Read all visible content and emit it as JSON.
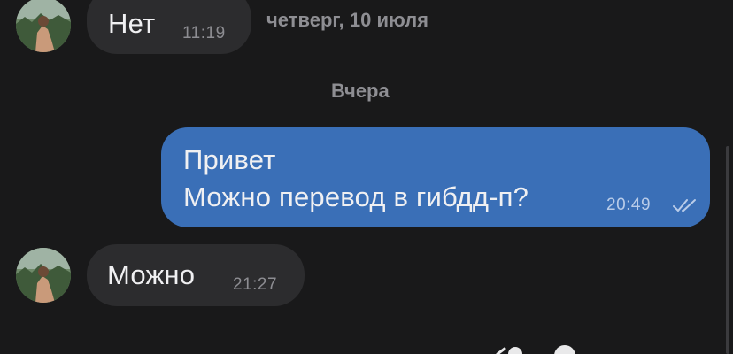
{
  "messages": [
    {
      "direction": "incoming",
      "text": "Нет",
      "time": "11:19"
    },
    {
      "direction": "outgoing",
      "lines": [
        "Привет",
        "Можно перевод в гибдд-п?"
      ],
      "time": "20:49",
      "status_icon": "double-check-icon"
    },
    {
      "direction": "incoming",
      "text": "Можно",
      "time": "21:27"
    }
  ],
  "date_separators": {
    "sticky": "четверг, 10 июля",
    "yesterday": "Вчера"
  },
  "colors": {
    "background": "#19191a",
    "incoming_bubble": "#2c2c2e",
    "outgoing_bubble": "#3a6fb7",
    "text": "#f0f0f2",
    "meta": "#8d8d92"
  }
}
